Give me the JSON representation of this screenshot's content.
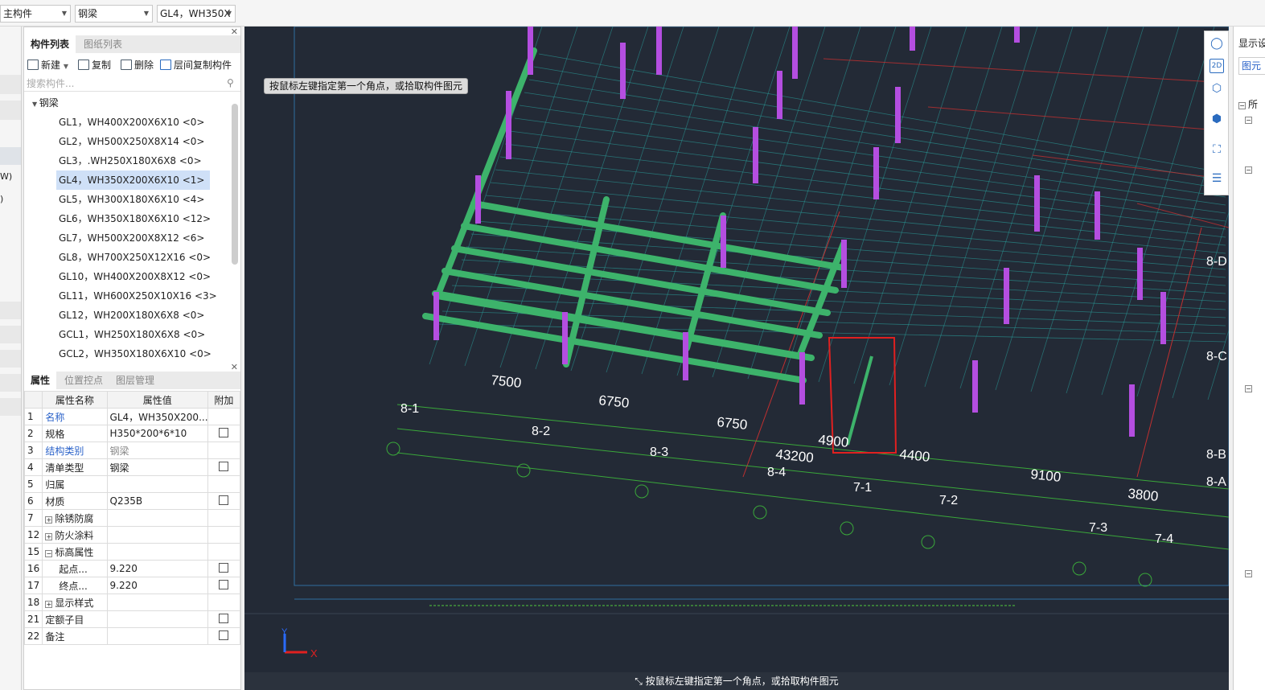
{
  "toolbar": {
    "combo1": "主构件",
    "combo2": "钢梁",
    "combo3": "GL4，WH350X"
  },
  "panel": {
    "tabs": [
      "构件列表",
      "图纸列表"
    ],
    "actions": {
      "new": "新建",
      "copy": "复制",
      "delete": "删除",
      "floor_copy": "层间复制构件"
    },
    "search_placeholder": "搜索构件...",
    "tree_root": "钢梁",
    "items": [
      "GL1，WH400X200X6X10 <0>",
      "GL2，WH500X250X8X14 <0>",
      "GL3，.WH250X180X6X8 <0>",
      "GL4，WH350X200X6X10 <1>",
      "GL5，WH300X180X6X10 <4>",
      "GL6，WH350X180X6X10 <12>",
      "GL7，WH500X200X8X12 <6>",
      "GL8，WH700X250X12X16 <0>",
      "GL10，WH400X200X8X12 <0>",
      "GL11，WH600X250X10X16 <3>",
      "GL12，WH200X180X6X8 <0>",
      "GCL1，WH250X180X6X8 <0>",
      "GCL2，WH350X180X6X10 <0>"
    ],
    "selected_index": 3
  },
  "props": {
    "tabs": [
      "属性",
      "位置控点",
      "图层管理"
    ],
    "headers": [
      "属性名称",
      "属性值",
      "附加"
    ],
    "rows": [
      {
        "no": "1",
        "name": "名称",
        "value": "GL4，WH350X200...",
        "blue": true,
        "chk": false,
        "exp": ""
      },
      {
        "no": "2",
        "name": "规格",
        "value": "H350*200*6*10",
        "blue": false,
        "chk": true,
        "exp": ""
      },
      {
        "no": "3",
        "name": "结构类别",
        "value": "钢梁",
        "blue": true,
        "grey": true,
        "chk": false,
        "exp": ""
      },
      {
        "no": "4",
        "name": "清单类型",
        "value": "钢梁",
        "blue": false,
        "chk": true,
        "exp": ""
      },
      {
        "no": "5",
        "name": "归属",
        "value": "",
        "blue": false,
        "chk": false,
        "exp": ""
      },
      {
        "no": "6",
        "name": "材质",
        "value": "Q235B",
        "blue": false,
        "chk": true,
        "exp": ""
      },
      {
        "no": "7",
        "name": "除锈防腐",
        "value": "",
        "blue": false,
        "chk": false,
        "exp": "+"
      },
      {
        "no": "12",
        "name": "防火涂料",
        "value": "",
        "blue": false,
        "chk": false,
        "exp": "+"
      },
      {
        "no": "15",
        "name": "标高属性",
        "value": "",
        "blue": false,
        "chk": false,
        "exp": "-"
      },
      {
        "no": "16",
        "name": "起点...",
        "value": "9.220",
        "blue": false,
        "chk": true,
        "exp": "",
        "indent": true
      },
      {
        "no": "17",
        "name": "终点...",
        "value": "9.220",
        "blue": false,
        "chk": true,
        "exp": "",
        "indent": true
      },
      {
        "no": "18",
        "name": "显示样式",
        "value": "",
        "blue": false,
        "chk": false,
        "exp": "+"
      },
      {
        "no": "21",
        "name": "定额子目",
        "value": "",
        "blue": false,
        "chk": true,
        "exp": ""
      },
      {
        "no": "22",
        "name": "备注",
        "value": "",
        "blue": false,
        "chk": true,
        "exp": ""
      }
    ]
  },
  "canvas": {
    "tooltip": "按鼠标左键指定第一个角点，或拾取构件图元",
    "status": "按鼠标左键指定第一个角点，或拾取构件图元",
    "dims": [
      "7500",
      "6750",
      "6750",
      "43200",
      "4900",
      "4400",
      "9100",
      "3800"
    ],
    "axes": [
      "8-1",
      "8-2",
      "8-3",
      "8-4",
      "7-1",
      "7-2",
      "7-3",
      "7-4",
      "8-D",
      "8-C",
      "8-B",
      "8-A"
    ],
    "ucs": {
      "x": "X",
      "y": "Y"
    },
    "colors": {
      "bg": "#232a36",
      "beam": "#3db36b",
      "column": "#b44ee0",
      "grid": "#2aa4a0",
      "highlight": "#e02020"
    }
  },
  "viewbar": {
    "icons": [
      "orbit-icon",
      "2d-icon",
      "3d-box-icon",
      "solid-box-icon",
      "fit-view-icon",
      "properties-icon"
    ],
    "label_2d": "2D"
  },
  "right": {
    "title": "显示设",
    "tab": "图元",
    "item": "所"
  }
}
